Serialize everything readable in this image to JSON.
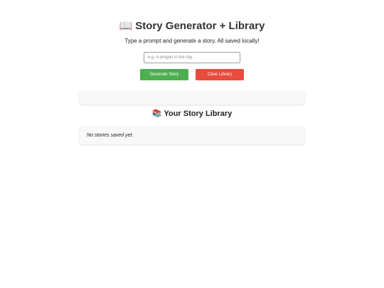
{
  "header": {
    "title_icon": "📖",
    "title": "Story Generator + Library",
    "subtitle": "Type a prompt and generate a story. All saved locally!"
  },
  "prompt": {
    "value": "",
    "placeholder": "e.g. A dragon in the city..."
  },
  "buttons": {
    "generate_label": "Generate Story",
    "clear_label": "Clear Library"
  },
  "output": {
    "text": ""
  },
  "library": {
    "heading_icon": "📚",
    "heading": "Your Story Library",
    "empty_message": "No stories saved yet."
  },
  "colors": {
    "generate_button": "#4caf50",
    "clear_button": "#e74c3c",
    "card_background": "#f8f8f8"
  }
}
